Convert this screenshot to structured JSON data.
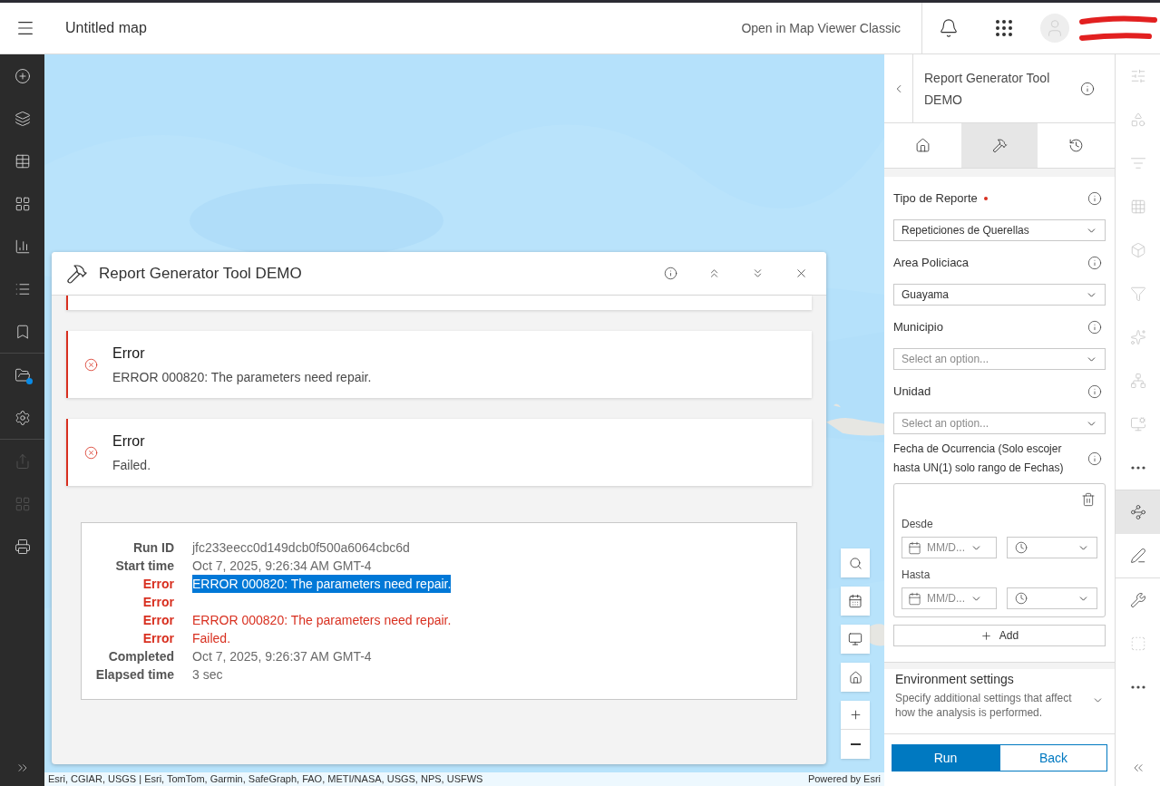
{
  "top_bar": {
    "title": "Untitled map",
    "link": "Open in Map Viewer Classic"
  },
  "left_sidebar": {
    "items": [
      {
        "disabled": false,
        "notification": false
      },
      {
        "disabled": false,
        "notification": false
      },
      {
        "disabled": false,
        "notification": false
      },
      {
        "disabled": false,
        "notification": false
      },
      {
        "disabled": false,
        "notification": false
      },
      {
        "disabled": false,
        "notification": false
      },
      {
        "disabled": false,
        "notification": false
      },
      {
        "disabled": false,
        "notification": true
      },
      {
        "disabled": false,
        "notification": false
      },
      {
        "disabled": true,
        "notification": false
      },
      {
        "disabled": true,
        "notification": false
      },
      {
        "disabled": false,
        "notification": false
      }
    ]
  },
  "dialog": {
    "title": "Report Generator Tool DEMO",
    "messages": [
      {
        "kind": "error",
        "title": "Error",
        "text": "ERROR 000820: The parameters need repair."
      },
      {
        "kind": "error",
        "title": "Error",
        "text": "Failed."
      }
    ],
    "details": [
      {
        "kind": "info",
        "label": "Run ID",
        "value": "jfc233eecc0d149dcb0f500a6064cbc6d",
        "selected": false
      },
      {
        "kind": "info",
        "label": "Start time",
        "value": "Oct 7, 2025, 9:26:34 AM GMT-4",
        "selected": false
      },
      {
        "kind": "error",
        "label": "Error",
        "value": "ERROR 000820: The parameters need repair.",
        "selected": true
      },
      {
        "kind": "error",
        "label": "Error",
        "selected": false
      },
      {
        "kind": "error",
        "label": "Error",
        "value": "ERROR 000820: The parameters need repair.",
        "selected": false
      },
      {
        "kind": "error",
        "label": "Error",
        "value": "Failed.",
        "selected": false
      },
      {
        "kind": "info",
        "label": "Completed",
        "value": "Oct 7, 2025, 9:26:37 AM GMT-4",
        "selected": false
      },
      {
        "kind": "info",
        "label": "Elapsed time",
        "value": "3 sec",
        "selected": false
      }
    ]
  },
  "attribution": {
    "sources": "Esri, CGIAR, USGS | Esri, TomTom, Garmin, SafeGraph, FAO, METI/NASA, USGS, NPS, USFWS",
    "powered_by": "Powered by Esri"
  },
  "tool_panel": {
    "title": "Report Generator Tool DEMO",
    "tabs": [
      {
        "selected": false
      },
      {
        "selected": true
      },
      {
        "selected": false
      }
    ],
    "fields": [
      {
        "label": "Tipo de Reporte",
        "required": true,
        "value": "Repeticiones de Querellas"
      },
      {
        "label": "Area Policiaca",
        "required": false,
        "value": "Guayama"
      },
      {
        "label": "Municipio",
        "required": false,
        "placeholder": "Select an option..."
      },
      {
        "label": "Unidad",
        "required": false,
        "placeholder": "Select an option..."
      }
    ],
    "date_range": {
      "label": "Fecha de Ocurrencia (Solo escojer hasta UN(1) solo rango de Fechas)",
      "rows": [
        {
          "label": "Desde",
          "date_placeholder": "MM/D..."
        },
        {
          "label": "Hasta",
          "date_placeholder": "MM/D..."
        }
      ],
      "add_button": "Add"
    },
    "environment": {
      "title": "Environment settings",
      "description": "Specify additional settings that affect how the analysis is performed.",
      "expanded": false
    },
    "buttons": [
      {
        "label": "Run",
        "kind": "primary"
      },
      {
        "label": "Back",
        "kind": "secondary"
      }
    ]
  },
  "right_toolbar": {
    "items": [
      {
        "disabled": true,
        "selected": false
      },
      {
        "disabled": true,
        "selected": false
      },
      {
        "disabled": true,
        "selected": false
      },
      {
        "disabled": true,
        "selected": false
      },
      {
        "disabled": true,
        "selected": false
      },
      {
        "disabled": true,
        "selected": false
      },
      {
        "disabled": true,
        "selected": false
      },
      {
        "disabled": true,
        "selected": false
      },
      {
        "disabled": true,
        "selected": false
      },
      {
        "disabled": false,
        "selected": false
      },
      {
        "disabled": false,
        "selected": true
      },
      {
        "disabled": false,
        "selected": false
      },
      {
        "disabled": false,
        "selected": false
      },
      {
        "disabled": true,
        "selected": false
      },
      {
        "disabled": false,
        "selected": false
      }
    ]
  }
}
